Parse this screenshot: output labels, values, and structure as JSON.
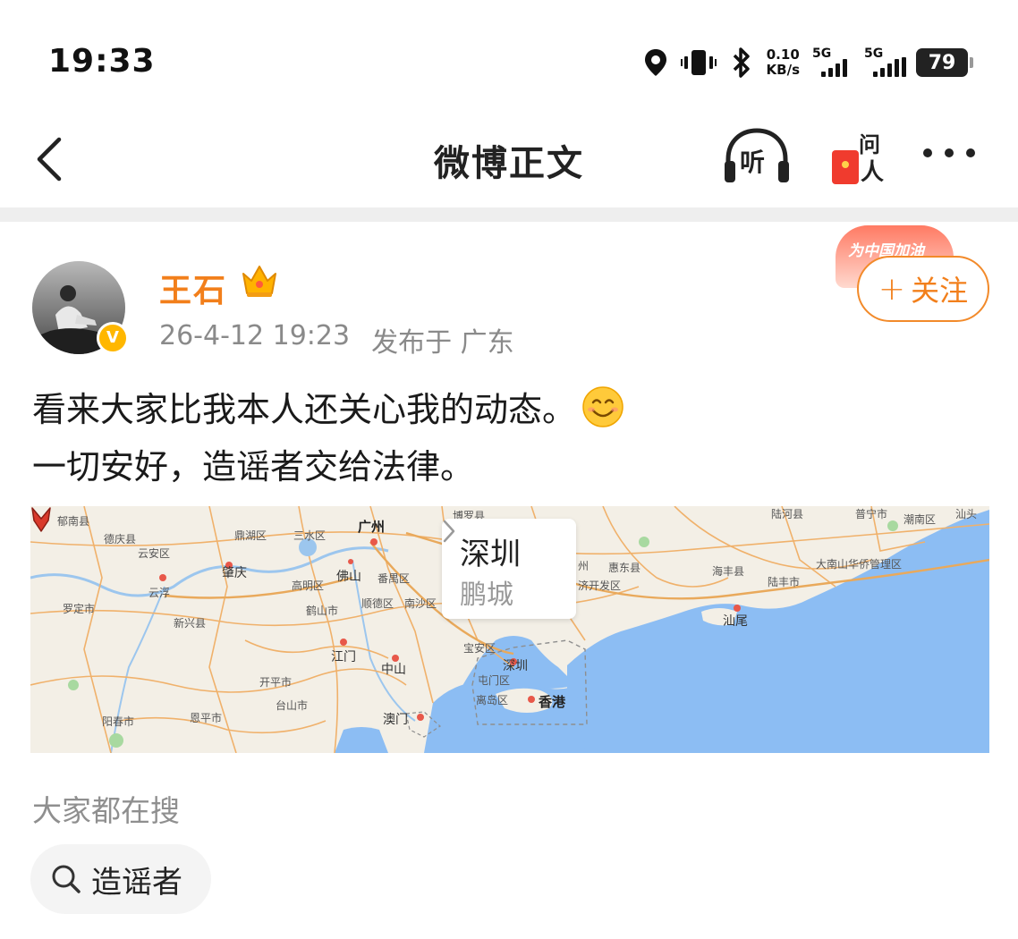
{
  "status_bar": {
    "time": "19:33",
    "net_speed_value": "0.10",
    "net_speed_unit": "KB/s",
    "sim1": "5G",
    "sim2": "5G",
    "battery": "79"
  },
  "nav": {
    "title": "微博正文",
    "listen_label": "听",
    "ask_label_1": "问",
    "ask_label_2": "人"
  },
  "post": {
    "author": "王石",
    "verified_badge": "V",
    "date": "26-4-12 19:23",
    "location": "发布于 广东",
    "campaign_badge": "为中国加油",
    "follow_label": "关注",
    "follow_plus": "+",
    "text_line1": "看来大家比我本人还关心我的动态。",
    "text_line2": "一切安好，造谣者交给法律。",
    "emoji": "smile-emoji"
  },
  "map": {
    "poi_name": "深圳",
    "poi_subtitle": "鹏城",
    "labels": {
      "l1": "郁南县",
      "l2": "德庆县",
      "l3": "云安区",
      "l4": "鼎湖区",
      "l5": "三水区",
      "l6": "广州",
      "l7": "番禺区",
      "l8": "佛山",
      "l9": "高明区",
      "l10": "顺德区",
      "l11": "南沙区",
      "l12": "肇庆",
      "l13": "云浮",
      "l14": "罗定市",
      "l15": "新兴县",
      "l16": "鹤山市",
      "l17": "江门",
      "l18": "中山",
      "l19": "开平市",
      "l20": "台山市",
      "l21": "恩平市",
      "l22": "阳春市",
      "l23": "澳门",
      "l24": "宝安区",
      "l25": "深圳",
      "l26": "屯门区",
      "l27": "离岛区",
      "l28": "香港",
      "l29": "惠东县",
      "l30": "海丰县",
      "l31": "陆丰市",
      "l32": "汕尾",
      "l33": "大南山华侨管理区",
      "l34": "济开发区",
      "l35": "潮南区",
      "l36": "陆河县",
      "l37": "普宁市",
      "l38": "汕头",
      "l39": "博罗县",
      "l40": "州"
    }
  },
  "search": {
    "heading": "大家都在搜",
    "chip_label": "造谣者"
  },
  "colors": {
    "accent": "#f27f1b",
    "sea": "#8cbdf3",
    "road": "#f0b16b"
  }
}
